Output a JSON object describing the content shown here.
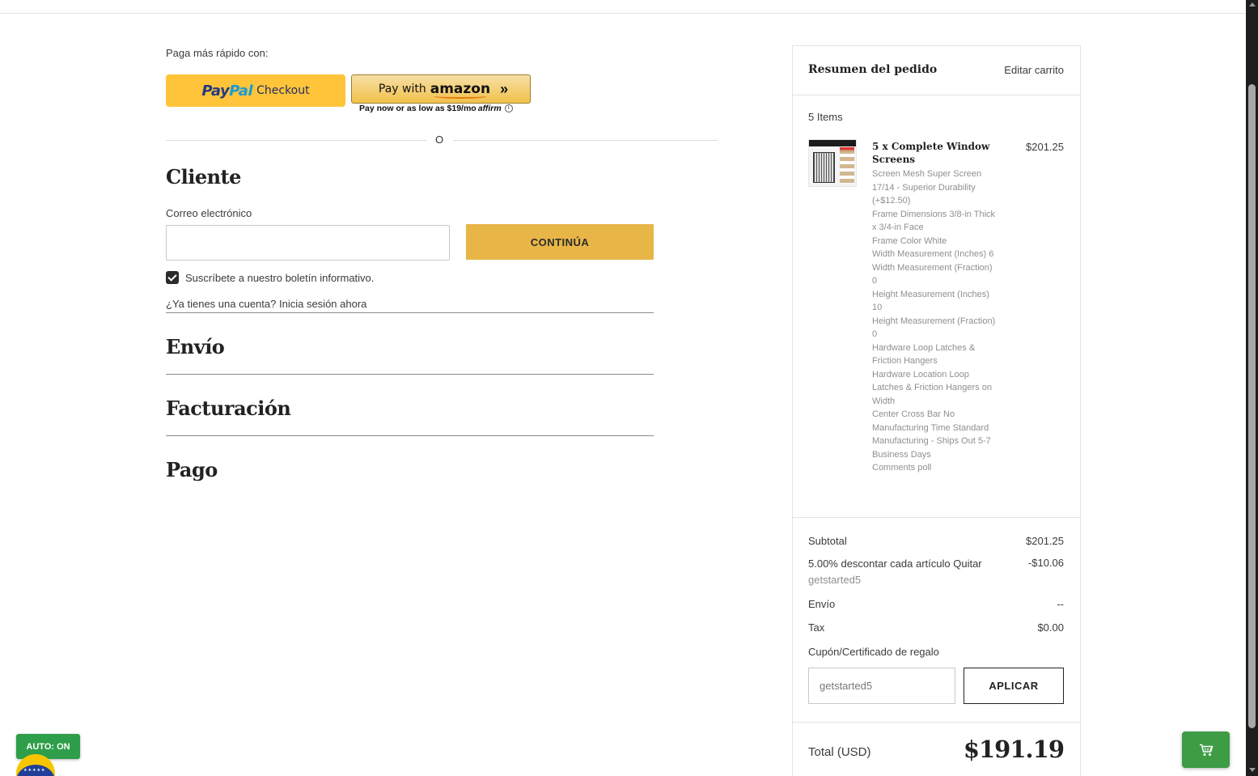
{
  "express": {
    "heading": "Paga más rápido con:",
    "paypal": {
      "brand_part1": "Pay",
      "brand_part2": "Pal",
      "label": "Checkout"
    },
    "amazon": {
      "prefix": "Pay with",
      "brand": "amazon",
      "arrows": "»"
    },
    "affirm": {
      "text": "Pay now or as low as $19/mo",
      "brand": "affirm",
      "info": "i"
    },
    "divider": "O"
  },
  "customer": {
    "title": "Cliente",
    "email_label": "Correo electrónico",
    "email_value": "",
    "continue_label": "CONTINÚA",
    "newsletter_label": "Suscríbete a nuestro boletín informativo.",
    "newsletter_checked": true,
    "account_prompt": "¿Ya tienes una cuenta?",
    "signin_link": "Inicia sesión ahora"
  },
  "steps": {
    "shipping": "Envío",
    "billing": "Facturación",
    "payment": "Pago"
  },
  "summary": {
    "title": "Resumen del pedido",
    "edit_label": "Editar carrito",
    "items_count": "5 Items",
    "item": {
      "name": "5 x Complete Window Screens",
      "price": "$201.25",
      "options": [
        "Screen Mesh Super Screen 17/14 - Superior Durability (+$12.50)",
        "Frame Dimensions 3/8-in Thick x 3/4-in Face",
        "Frame Color White",
        "Width Measurement (Inches) 6",
        "Width Measurement (Fraction) 0",
        "Height Measurement (Inches) 10",
        "Height Measurement (Fraction) 0",
        "Hardware Loop Latches & Friction Hangers",
        "Hardware Location Loop Latches & Friction Hangers on Width",
        "Center Cross Bar No",
        "Manufacturing Time Standard Manufacturing - Ships Out 5-7 Business Days",
        "Comments poll"
      ]
    },
    "subtotal_label": "Subtotal",
    "subtotal_value": "$201.25",
    "discount_label": "5.00% descontar cada artículo",
    "discount_remove": "Quitar",
    "discount_code": "getstarted5",
    "discount_value": "-$10.06",
    "shipping_label": "Envío",
    "shipping_value": "--",
    "tax_label": "Tax",
    "tax_value": "$0.00",
    "coupon_label": "Cupón/Certificado de regalo",
    "coupon_value": "getstarted5",
    "apply_label": "APLICAR",
    "total_label": "Total (USD)",
    "total_value": "$191.19"
  },
  "widgets": {
    "auto_badge": "AUTO: ON",
    "flag_icon": "brazil-flag-icon",
    "cart_icon": "cart-icon"
  },
  "colors": {
    "paypal_yellow": "#ffc439",
    "continue_gold": "#e8b547",
    "cart_green": "#3e9c45",
    "auto_green": "#2f9e4a"
  }
}
